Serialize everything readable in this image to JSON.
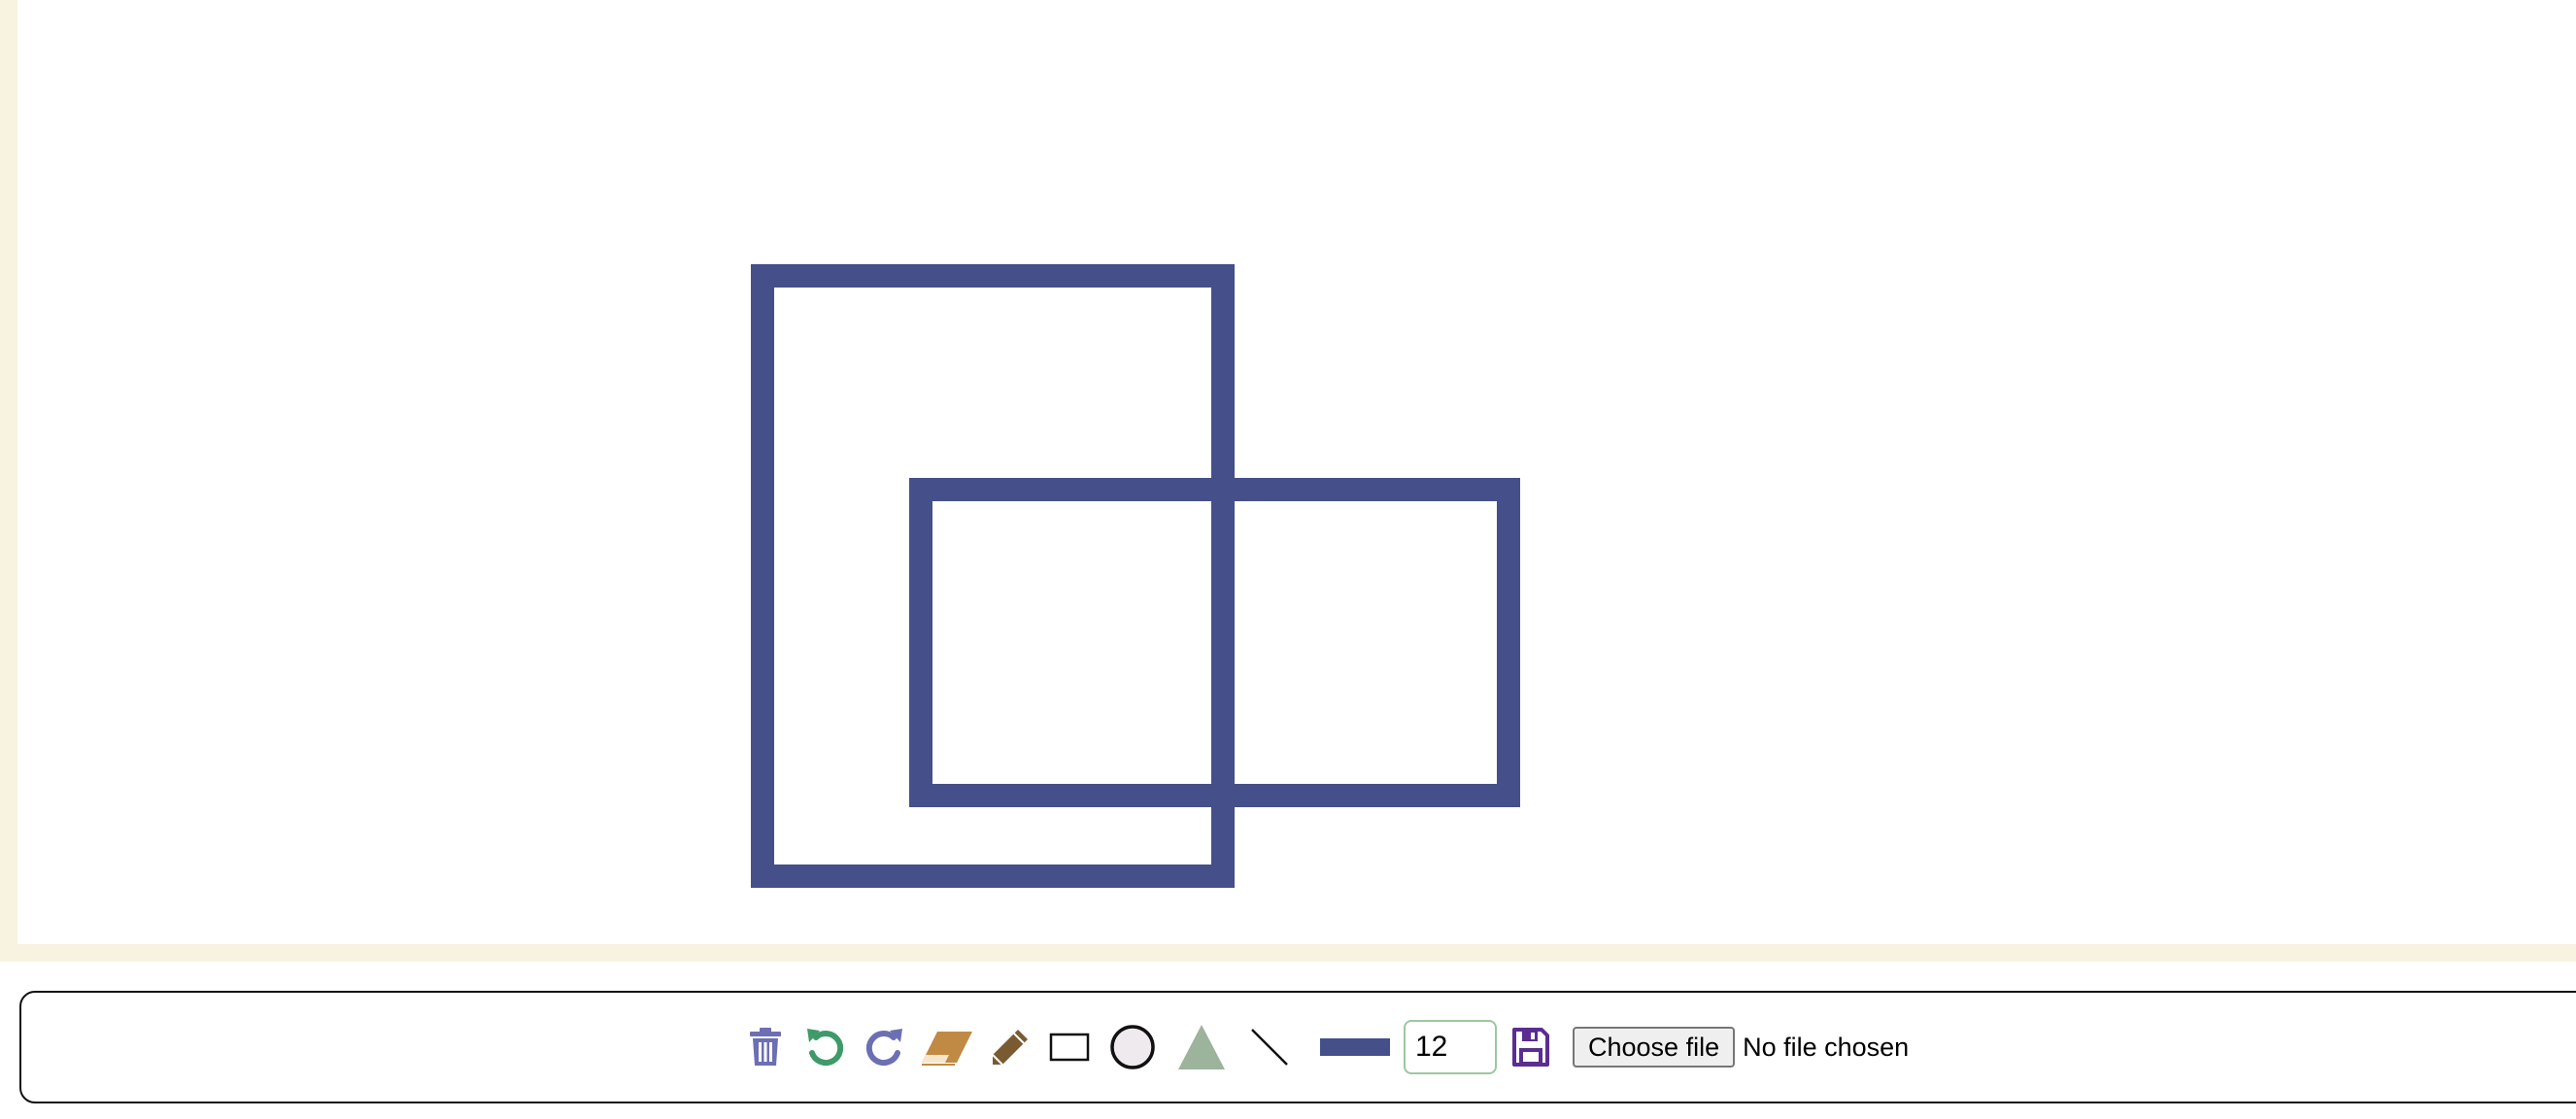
{
  "colors": {
    "stroke": "#454f8a",
    "frame": "#f7f3e0",
    "canvas": "#ffffff",
    "trash": "#6d6fb3",
    "undo": "#3f9a6a",
    "redo": "#6d6fb3",
    "eraser": "#c08a45",
    "pencil": "#7a5a30",
    "triangle": "#9cb39c",
    "save": "#5a2d91"
  },
  "canvas": {
    "shapes": [
      {
        "type": "rectangle",
        "stroke_width": 12,
        "fill": "none"
      },
      {
        "type": "rectangle",
        "stroke_width": 12,
        "fill": "none"
      }
    ]
  },
  "toolbar": {
    "tools": [
      {
        "name": "trash-icon",
        "icon": "trash"
      },
      {
        "name": "undo-icon",
        "icon": "undo"
      },
      {
        "name": "redo-icon",
        "icon": "redo"
      },
      {
        "name": "eraser-icon",
        "icon": "eraser"
      },
      {
        "name": "pencil-icon",
        "icon": "pencil"
      },
      {
        "name": "rectangle-tool-icon",
        "icon": "rectangle"
      },
      {
        "name": "circle-tool-icon",
        "icon": "circle"
      },
      {
        "name": "triangle-tool-icon",
        "icon": "triangle"
      },
      {
        "name": "line-tool-icon",
        "icon": "line"
      }
    ],
    "stroke_size": "12",
    "save_icon": "floppy-disk-icon",
    "file_button_label": "Choose file",
    "file_status": "No file chosen"
  }
}
